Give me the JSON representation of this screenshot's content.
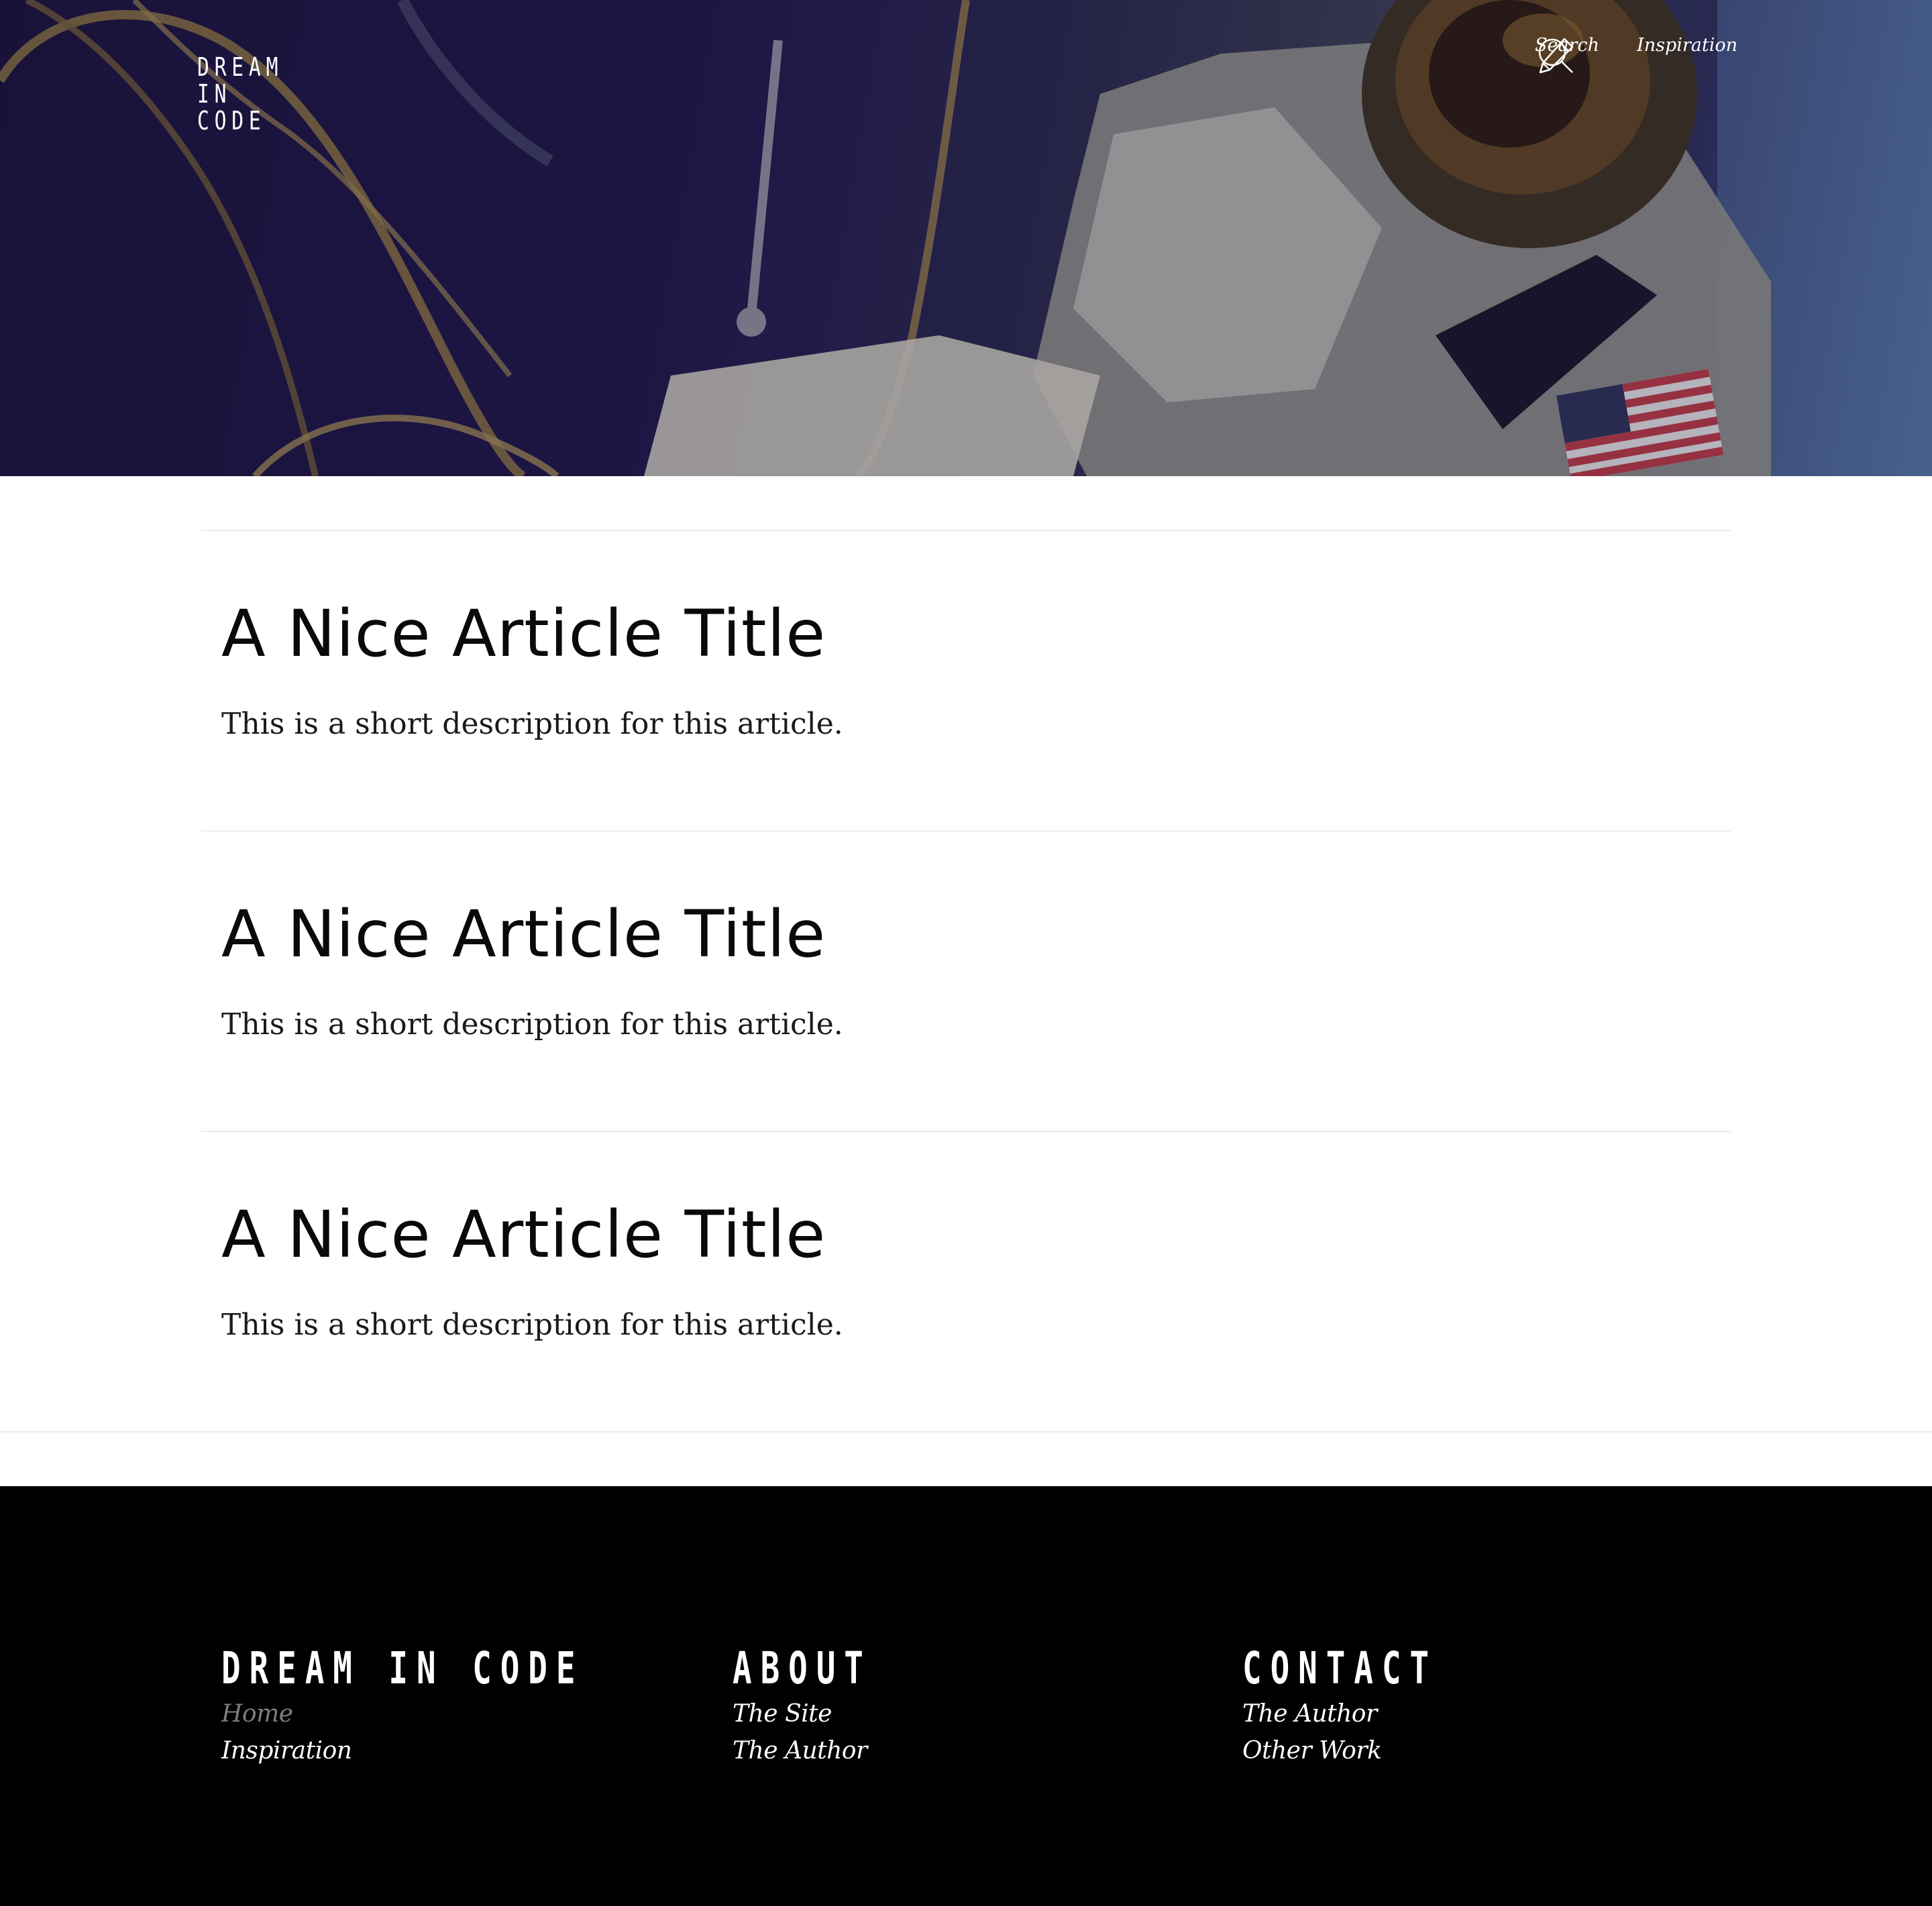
{
  "header": {
    "logo": "DREAM IN CODE",
    "nav": [
      {
        "label": "Search",
        "icon": "search-icon"
      },
      {
        "label": "Inspiration",
        "icon": "pencil-icon"
      }
    ]
  },
  "articles": [
    {
      "title": "A Nice Article Title",
      "description": "This is a short description for this article."
    },
    {
      "title": "A Nice Article Title",
      "description": "This is a short description for this article."
    },
    {
      "title": "A Nice Article Title",
      "description": "This is a short description for this article."
    }
  ],
  "footer": {
    "columns": [
      {
        "heading": "DREAM IN CODE",
        "links": [
          {
            "label": "Home",
            "state": "current"
          },
          {
            "label": "Inspiration"
          }
        ]
      },
      {
        "heading": "ABOUT",
        "links": [
          {
            "label": "The Site"
          },
          {
            "label": "The Author"
          }
        ]
      },
      {
        "heading": "CONTACT",
        "links": [
          {
            "label": "The Author"
          },
          {
            "label": "Other Work"
          }
        ]
      }
    ]
  },
  "colors": {
    "footer_background": "#000000",
    "muted_link": "#7d7d7d",
    "divider": "#ececec"
  }
}
